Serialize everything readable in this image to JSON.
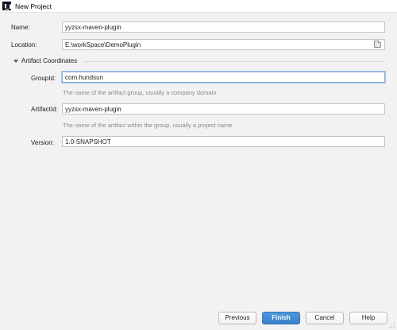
{
  "window": {
    "title": "New Project",
    "app_icon": "intellij-idea-icon"
  },
  "form": {
    "name_label": "Name:",
    "name_value": "yyzsx-maven-plugin",
    "location_label": "Location:",
    "location_value": "E:\\workSpace\\DemoPlugin",
    "browse_icon": "folder-icon"
  },
  "artifact": {
    "section_title": "Artifact Coordinates",
    "groupid_label": "GroupId:",
    "groupid_value": "com.hundsun",
    "groupid_hint": "The name of the artifact group, usually a company domain",
    "artifactid_label": "ArtifactId:",
    "artifactid_value": "yyzsx-maven-plugin",
    "artifactid_hint": "The name of the artifact within the group, usually a project name",
    "version_label": "Version:",
    "version_value": "1.0-SNAPSHOT"
  },
  "buttons": {
    "previous": "Previous",
    "finish": "Finish",
    "cancel": "Cancel",
    "help": "Help"
  },
  "colors": {
    "primary_button": "#3980c9",
    "focus_ring": "#87afda"
  }
}
